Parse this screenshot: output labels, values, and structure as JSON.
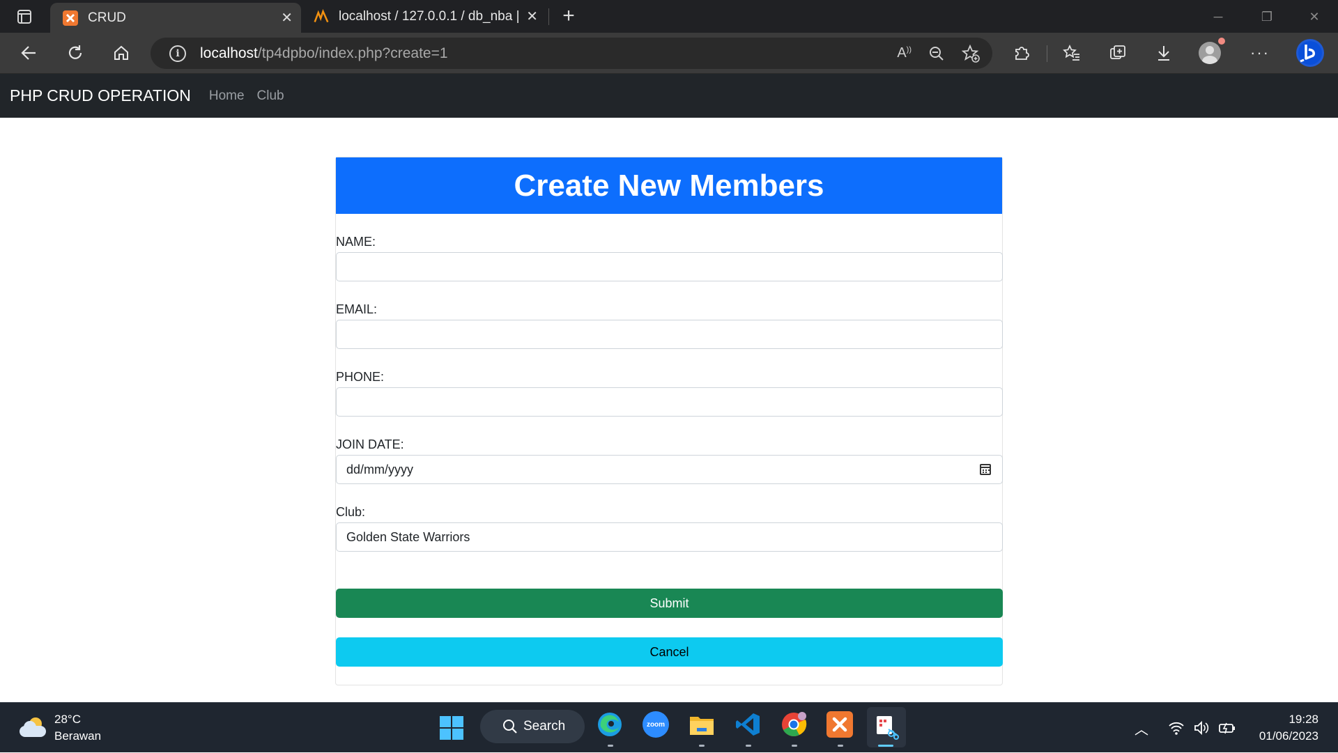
{
  "browser": {
    "tabs": [
      {
        "title": "CRUD",
        "active": true
      },
      {
        "title": "localhost / 127.0.0.1 / db_nba | p",
        "active": false
      }
    ],
    "address": {
      "host": "localhost",
      "path": "/tp4dpbo/index.php?create=1"
    }
  },
  "navbar": {
    "brand": "PHP CRUD OPERATION",
    "links": [
      "Home",
      "Club"
    ]
  },
  "form": {
    "title": "Create New Members",
    "fields": [
      {
        "label": "NAME:",
        "value": ""
      },
      {
        "label": "EMAIL:",
        "value": ""
      },
      {
        "label": "PHONE:",
        "value": ""
      },
      {
        "label": "JOIN DATE:",
        "placeholder": "dd/mm/yyyy"
      },
      {
        "label": "Club:",
        "value": "Golden State Warriors"
      }
    ],
    "submit_label": "Submit",
    "cancel_label": "Cancel",
    "colors": {
      "header": "#0d6efd",
      "submit": "#198754",
      "cancel": "#0dcaf0"
    }
  },
  "taskbar": {
    "weather": {
      "temp": "28°C",
      "desc": "Berawan"
    },
    "search_label": "Search",
    "zoom_label": "zoom",
    "clock": {
      "time": "19:28",
      "date": "01/06/2023"
    }
  }
}
